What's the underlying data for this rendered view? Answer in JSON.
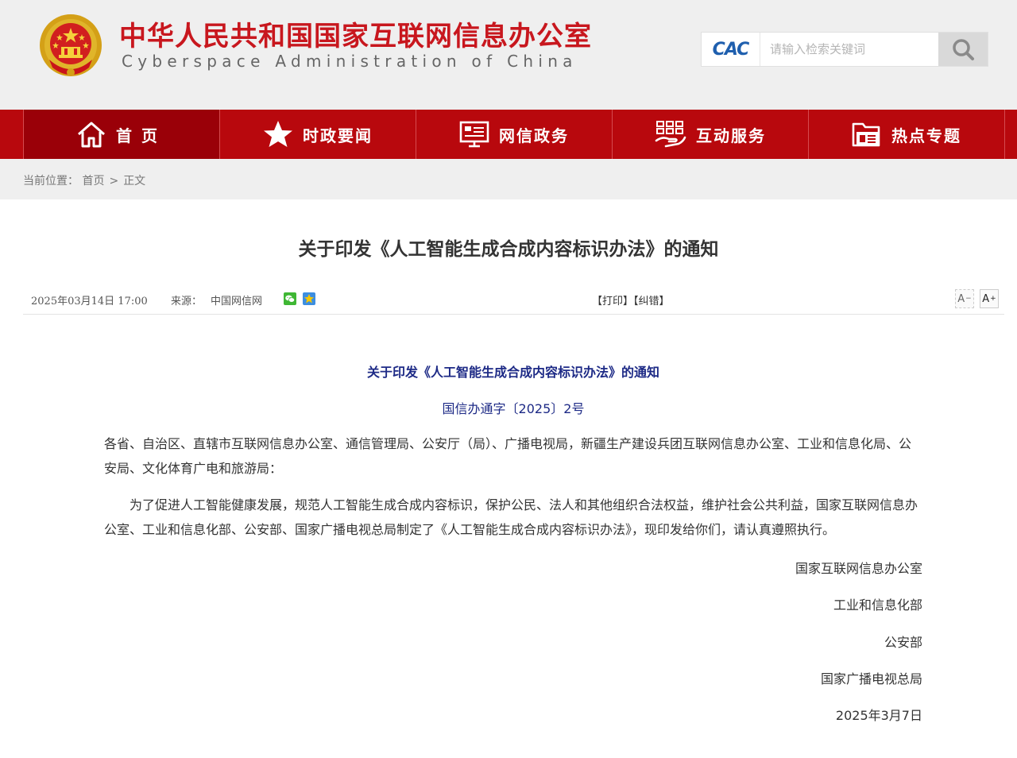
{
  "header": {
    "site_title": "中华人民共和国国家互联网信息办公室",
    "site_subtitle": "Cyberspace Administration of China",
    "search_placeholder": "请输入检索关键词",
    "search_logo": "CAC"
  },
  "nav": {
    "items": [
      {
        "label": "首页",
        "icon": "home-icon",
        "active": true
      },
      {
        "label": "时政要闻",
        "icon": "star-icon"
      },
      {
        "label": "网信政务",
        "icon": "presentation-icon"
      },
      {
        "label": "互动服务",
        "icon": "hand-service-icon"
      },
      {
        "label": "热点专题",
        "icon": "folder-icon"
      }
    ]
  },
  "breadcrumb": {
    "label": "当前位置：",
    "home": "首页",
    "separator": ">",
    "current": "正文"
  },
  "article": {
    "title": "关于印发《人工智能生成合成内容标识办法》的通知",
    "date": "2025年03月14日  17:00",
    "source_label": "来源：",
    "source": "中国网信网",
    "print_label": "【打印】",
    "report_label": "【纠错】",
    "font_small": "A",
    "font_large": "A",
    "doc_title": "关于印发《人工智能生成合成内容标识办法》的通知",
    "doc_number": "国信办通字〔2025〕2号",
    "paragraphs": [
      "各省、自治区、直辖市互联网信息办公室、通信管理局、公安厅（局）、广播电视局，新疆生产建设兵团互联网信息办公室、工业和信息化局、公安局、文化体育广电和旅游局：",
      "为了促进人工智能健康发展，规范人工智能生成合成内容标识，保护公民、法人和其他组织合法权益，维护社会公共利益，国家互联网信息办公室、工业和信息化部、公安部、国家广播电视总局制定了《人工智能生成合成内容标识办法》，现印发给你们，请认真遵照执行。"
    ],
    "signatures": [
      "国家互联网信息办公室",
      "工业和信息化部",
      "公安部",
      "国家广播电视总局"
    ],
    "sign_date": "2025年3月7日"
  },
  "colors": {
    "brand_red": "#c8171e",
    "nav_red": "#b8080d",
    "nav_active": "#9a0008",
    "doc_blue": "#1d2a86"
  }
}
